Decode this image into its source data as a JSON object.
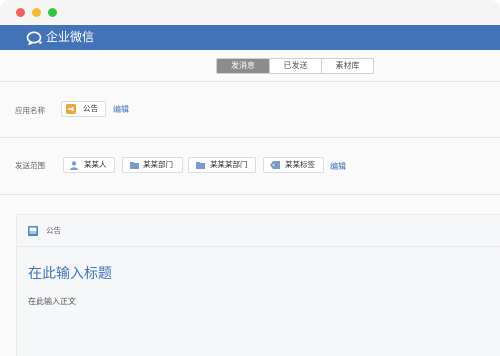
{
  "window": {
    "title": ""
  },
  "app": {
    "brand": "企业微信"
  },
  "tabs": [
    {
      "label": "发消息",
      "selected": true
    },
    {
      "label": "已发送",
      "selected": false
    },
    {
      "label": "素材库",
      "selected": false
    }
  ],
  "form": {
    "app_name_label": "应用名称",
    "app_name_value": "公告",
    "edit_label": "编辑",
    "send_scope_label": "发送范围",
    "recipients": [
      {
        "label": "某某人",
        "icon": "person-icon"
      },
      {
        "label": "某某部门",
        "icon": "folder-icon"
      },
      {
        "label": "某某某部门",
        "icon": "folder-icon"
      },
      {
        "label": "某某标签",
        "icon": "tag-icon"
      }
    ]
  },
  "message": {
    "app_label": "公告",
    "title_placeholder": "在此输入标题",
    "body_placeholder": "在此输入正文"
  },
  "colors": {
    "brand_bar": "#4273b8",
    "accent_orange": "#f0a33a",
    "link": "#3a6fb0"
  }
}
